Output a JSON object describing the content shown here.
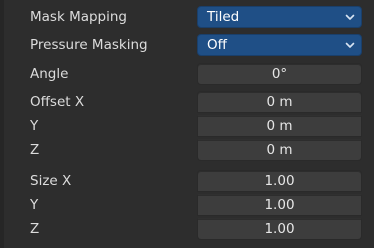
{
  "properties": {
    "mask_mapping": {
      "label": "Mask Mapping",
      "value": "Tiled"
    },
    "pressure_masking": {
      "label": "Pressure Masking",
      "value": "Off"
    },
    "angle": {
      "label": "Angle",
      "value": "0°"
    },
    "offset": {
      "label_x": "Offset X",
      "label_y": "Y",
      "label_z": "Z",
      "x": "0 m",
      "y": "0 m",
      "z": "0 m"
    },
    "size": {
      "label_x": "Size X",
      "label_y": "Y",
      "label_z": "Z",
      "x": "1.00",
      "y": "1.00",
      "z": "1.00"
    }
  },
  "icons": {
    "dropdown": "chevron-down-icon"
  },
  "colors": {
    "enum_field": "#1f4f86",
    "panel_bg": "#2d2d2d",
    "number_field": "#3d3d3d"
  }
}
